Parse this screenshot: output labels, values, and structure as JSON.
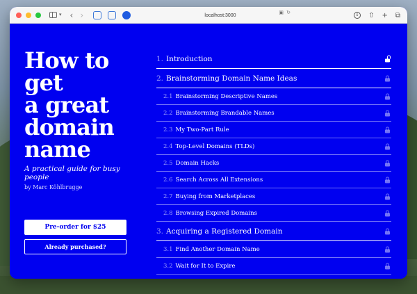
{
  "browser": {
    "address": "localhost:3000",
    "icons": [
      "sidebar-icon",
      "chevron-down-icon",
      "back-icon",
      "forward-icon",
      "extension-icon",
      "extension-icon",
      "extension-icon",
      "translate-icon",
      "reload-icon",
      "download-icon",
      "share-icon",
      "new-tab-icon",
      "tabs-icon"
    ]
  },
  "book": {
    "title_lines": [
      "How to get",
      "a great",
      "domain",
      "name"
    ],
    "subtitle": "A practical guide for busy people",
    "author": "by Marc Köhlbrugge"
  },
  "actions": {
    "preorder_label": "Pre-order for $25",
    "purchased_label": "Already purchased?"
  },
  "toc": [
    {
      "num": "1.",
      "title": "Introduction",
      "kind": "chapter",
      "unlocked": true
    },
    {
      "num": "2.",
      "title": "Brainstorming Domain Name Ideas",
      "kind": "chapter",
      "unlocked": false
    },
    {
      "num": "2.1",
      "title": "Brainstorming Descriptive Names",
      "kind": "section",
      "unlocked": false
    },
    {
      "num": "2.2",
      "title": "Brainstorming Brandable Names",
      "kind": "section",
      "unlocked": false
    },
    {
      "num": "2.3",
      "title": "My Two-Part Rule",
      "kind": "section",
      "unlocked": false
    },
    {
      "num": "2.4",
      "title": "Top-Level Domains (TLDs)",
      "kind": "section",
      "unlocked": false
    },
    {
      "num": "2.5",
      "title": "Domain Hacks",
      "kind": "section",
      "unlocked": false
    },
    {
      "num": "2.6",
      "title": "Search Across All Extensions",
      "kind": "section",
      "unlocked": false
    },
    {
      "num": "2.7",
      "title": "Buying from Marketplaces",
      "kind": "section",
      "unlocked": false
    },
    {
      "num": "2.8",
      "title": "Browsing Expired Domains",
      "kind": "section",
      "unlocked": false
    },
    {
      "num": "3.",
      "title": "Acquiring a Registered Domain",
      "kind": "chapter",
      "unlocked": false
    },
    {
      "num": "3.1",
      "title": "Find Another Domain Name",
      "kind": "section",
      "unlocked": false
    },
    {
      "num": "3.2",
      "title": "Wait for It to Expire",
      "kind": "section",
      "unlocked": false
    }
  ],
  "colors": {
    "page_background": "#0000f0",
    "text": "#ffffff",
    "button_background": "#ffffff"
  }
}
